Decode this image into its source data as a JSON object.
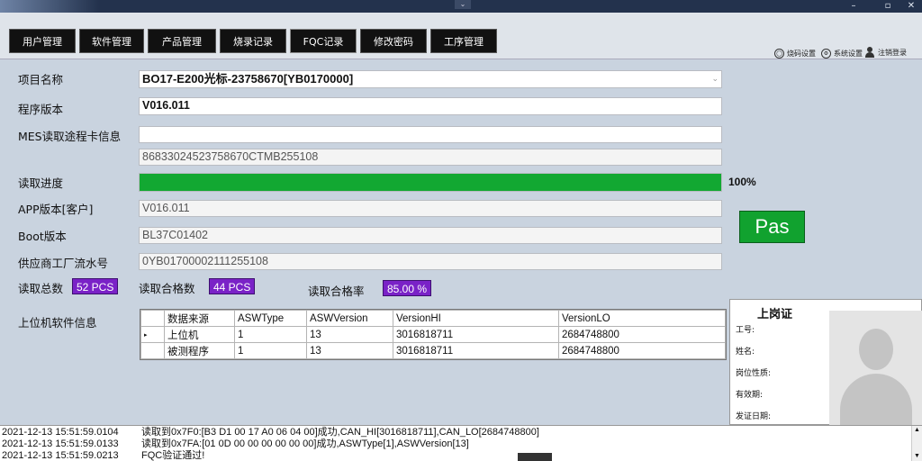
{
  "nav": {
    "tabs": [
      "用户管理",
      "软件管理",
      "产品管理",
      "烧录记录",
      "FQC记录",
      "修改密码",
      "工序管理"
    ],
    "active_tab": "FQC记录",
    "right_links": [
      {
        "icon": "cycle-icon",
        "label": "烧码设置"
      },
      {
        "icon": "settings-icon",
        "label": "系统设置"
      },
      {
        "icon": "user-icon",
        "label": "注销登录"
      }
    ]
  },
  "form": {
    "project_label": "项目名称",
    "project_value": "BO17-E200光标-23758670[YB0170000]",
    "program_version_label": "程序版本",
    "program_version_value": "V016.011",
    "mes_label": "MES读取途程卡信息",
    "mes_value": "",
    "mes_code": "86833024523758670CTMB255108",
    "progress_label": "读取进度",
    "progress_percent": 100,
    "progress_text": "100%",
    "app_version_label": "APP版本[客户]",
    "app_version_value": "V016.011",
    "boot_label": "Boot版本",
    "boot_value": "BL37C01402",
    "serial_label": "供应商工厂流水号",
    "serial_value": "0YB01700002111255108",
    "result": "Pas"
  },
  "stats": {
    "total_label": "读取总数",
    "total_value": "52 PCS",
    "pass_label": "读取合格数",
    "pass_value": "44 PCS",
    "rate_label": "读取合格率",
    "rate_value": "85.00 %"
  },
  "software_info": {
    "label": "上位机软件信息",
    "columns": [
      "数据来源",
      "ASWType",
      "ASWVersion",
      "VersionHI",
      "VersionLO"
    ],
    "rows": [
      [
        "上位机",
        "1",
        "13",
        "3016818711",
        "2684748800"
      ],
      [
        "被测程序",
        "1",
        "13",
        "3016818711",
        "2684748800"
      ]
    ],
    "row_marker": "▸"
  },
  "badge": {
    "title": "上岗证",
    "fields": [
      "工号:",
      "姓名:",
      "岗位性质:",
      "有效期:",
      "发证日期:"
    ]
  },
  "log": [
    {
      "time": "2021-12-13 15:51:59.0104",
      "msg": "读取到0x7F0:[B3 D1 00 17 A0 06 04 00]成功,CAN_HI[3016818711],CAN_LO[2684748800]"
    },
    {
      "time": "2021-12-13 15:51:59.0133",
      "msg": "读取到0x7FA:[01 0D 00 00 00 00 00 00]成功,ASWType[1],ASWVersion[13]"
    },
    {
      "time": "2021-12-13 15:51:59.0213",
      "msg": "FQC验证通过!"
    }
  ],
  "colors": {
    "progress": "#12a832",
    "pass_box": "#11a22f",
    "badge": "#7a22c7",
    "titlebar": "#23324d"
  }
}
